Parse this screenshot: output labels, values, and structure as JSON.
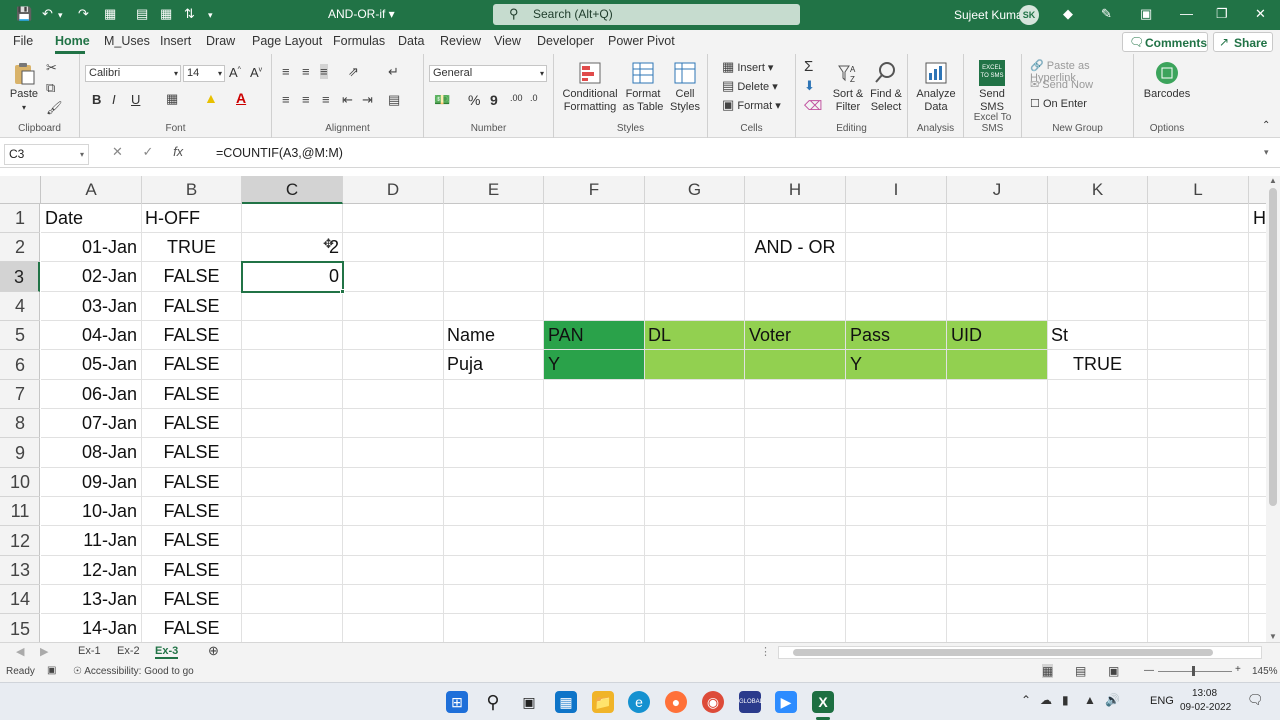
{
  "app": {
    "doc_title": "AND-OR-if",
    "search_placeholder": "Search (Alt+Q)",
    "user_name": "Sujeet Kumar",
    "user_initials": "SK"
  },
  "tabs": [
    "File",
    "Home",
    "M_Uses",
    "Insert",
    "Draw",
    "Page Layout",
    "Formulas",
    "Data",
    "Review",
    "View",
    "Developer",
    "Power Pivot"
  ],
  "header_buttons": {
    "comments": "Comments",
    "share": "Share"
  },
  "ribbon": {
    "clipboard": {
      "paste": "Paste",
      "label": "Clipboard"
    },
    "font": {
      "name": "Calibri",
      "size": "14",
      "label": "Font"
    },
    "alignment": {
      "label": "Alignment"
    },
    "number": {
      "format": "General",
      "label": "Number"
    },
    "styles": {
      "cond": "Conditional Formatting",
      "fmt_table": "Format as Table",
      "cell_styles": "Cell Styles",
      "label": "Styles"
    },
    "cells": {
      "insert": "Insert",
      "delete": "Delete",
      "format": "Format",
      "label": "Cells"
    },
    "editing": {
      "sort": "Sort & Filter",
      "find": "Find & Select",
      "label": "Editing"
    },
    "analysis": {
      "analyze": "Analyze Data",
      "label": "Analysis"
    },
    "sms": {
      "send": "Send SMS",
      "label": "Excel To SMS",
      "icon_text": "EXCEL TO SMS"
    },
    "newgroup": {
      "paste_link": "Paste as Hyperlink",
      "send_now": "Send Now",
      "on_enter": "On Enter",
      "label": "New Group"
    },
    "options": {
      "barcodes": "Barcodes",
      "label": "Options"
    }
  },
  "formula_bar": {
    "name_box": "C3",
    "fx": "fx",
    "formula": "=COUNTIF(A3,@M:M)"
  },
  "columns": [
    "A",
    "B",
    "C",
    "D",
    "E",
    "F",
    "G",
    "H",
    "I",
    "J",
    "K",
    "L"
  ],
  "rows": [
    "1",
    "2",
    "3",
    "4",
    "5",
    "6",
    "7",
    "8",
    "9",
    "10",
    "11",
    "12",
    "13",
    "14",
    "15"
  ],
  "cells": {
    "a1": "Date",
    "b1": "H-OFF",
    "m1_clip": "H",
    "c2": "2",
    "c3": "0",
    "h2": "AND - OR",
    "e5": "Name",
    "f5": "PAN",
    "g5": "DL",
    "h5": "Voter",
    "i5": "Pass",
    "j5": "UID",
    "k5": "St",
    "e6": "Puja",
    "f6": "Y",
    "i6": "Y",
    "k6": "TRUE",
    "dates": [
      "01-Jan",
      "02-Jan",
      "03-Jan",
      "04-Jan",
      "05-Jan",
      "06-Jan",
      "07-Jan",
      "08-Jan",
      "09-Jan",
      "10-Jan",
      "11-Jan",
      "12-Jan",
      "13-Jan",
      "14-Jan"
    ],
    "hoff": [
      "TRUE",
      "FALSE",
      "FALSE",
      "FALSE",
      "FALSE",
      "FALSE",
      "FALSE",
      "FALSE",
      "FALSE",
      "FALSE",
      "FALSE",
      "FALSE",
      "FALSE",
      "FALSE"
    ]
  },
  "colors": {
    "excel_green": "#217346",
    "pan_fill": "#2aa24a",
    "light_green_fill": "#92d050"
  },
  "sheets": [
    "Ex-1",
    "Ex-2",
    "Ex-3"
  ],
  "active_sheet": "Ex-3",
  "status": {
    "ready": "Ready",
    "accessibility": "Accessibility: Good to go",
    "zoom": "145%"
  },
  "taskbar": {
    "lang": "ENG",
    "time": "13:08",
    "date": "09-02-2022"
  }
}
